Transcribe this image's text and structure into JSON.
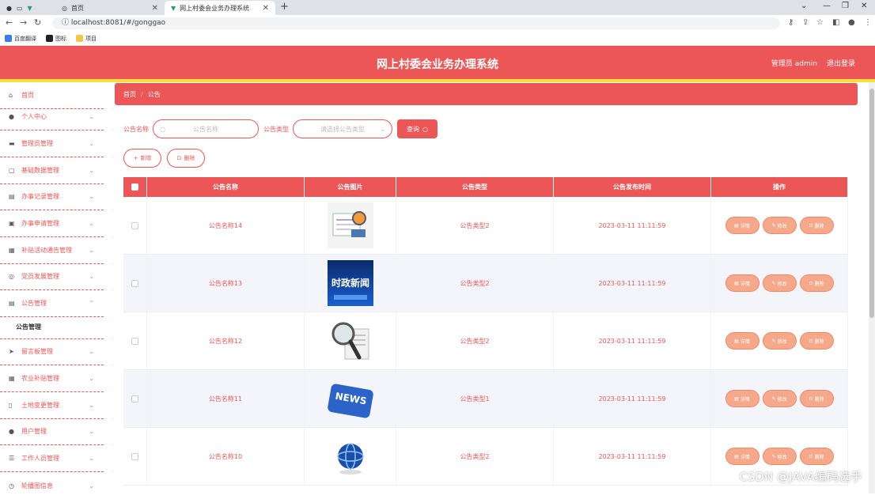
{
  "browser": {
    "tab1_title": "首页",
    "tab2_title": "网上村委会业务办理系统",
    "url": "localhost:8081/#/gonggao",
    "bookmarks": [
      "百度翻译",
      "图标",
      "项目"
    ]
  },
  "header": {
    "title": "网上村委会业务办理系统",
    "user_label": "管理员 admin",
    "logout_label": "退出登录"
  },
  "sidebar": {
    "items": [
      {
        "label": "首页",
        "icon": "home-icon"
      },
      {
        "label": "个人中心",
        "icon": "person-icon"
      },
      {
        "label": "管理员管理",
        "icon": "admin-icon"
      },
      {
        "label": "基础数据管理",
        "icon": "chat-icon"
      },
      {
        "label": "办事记录管理",
        "icon": "list-icon"
      },
      {
        "label": "办事申请管理",
        "icon": "briefcase-icon"
      },
      {
        "label": "补贴活动通告管理",
        "icon": "printer-icon"
      },
      {
        "label": "党员发展管理",
        "icon": "globe-icon"
      },
      {
        "label": "公告管理",
        "icon": "clipboard-icon"
      },
      {
        "label": "公告管理"
      },
      {
        "label": "留言板管理",
        "icon": "send-icon"
      },
      {
        "label": "农业补贴管理",
        "icon": "grid-icon"
      },
      {
        "label": "土地变更管理",
        "icon": "phone-icon"
      },
      {
        "label": "用户管理",
        "icon": "location-icon"
      },
      {
        "label": "工作人员管理",
        "icon": "menu-icon"
      },
      {
        "label": "轮播图信息",
        "icon": "clock-icon"
      }
    ]
  },
  "breadcrumb": {
    "home": "首页",
    "sep": "/",
    "current": "公告"
  },
  "search": {
    "name_label": "公告名称",
    "name_placeholder": "公告名称",
    "type_label": "公告类型",
    "type_placeholder": "请选择公告类型",
    "search_button": "查询"
  },
  "actions": {
    "add_label": "新增",
    "delete_label": "删除"
  },
  "table": {
    "headers": [
      "公告名称",
      "公告图片",
      "公告类型",
      "公告发布时间",
      "操作"
    ],
    "op_labels": {
      "detail": "详情",
      "edit": "修改",
      "delete": "删除"
    },
    "rows": [
      {
        "name": "公告名称14",
        "type": "公告类型2",
        "time": "2023-03-11 11:11:59",
        "image": "news-paper-image"
      },
      {
        "name": "公告名称13",
        "type": "公告类型2",
        "time": "2023-03-11 11:11:59",
        "image": "politics-news-image",
        "image_text": "时政新闻"
      },
      {
        "name": "公告名称12",
        "type": "公告类型2",
        "time": "2023-03-11 11:11:59",
        "image": "magnifier-news-image"
      },
      {
        "name": "公告名称11",
        "type": "公告类型1",
        "time": "2023-03-11 11:11:59",
        "image": "news-key-image",
        "image_text": "NEWS"
      },
      {
        "name": "公告名称10",
        "type": "公告类型2",
        "time": "2023-03-11 11:11:59",
        "image": "globe-news-image"
      }
    ]
  },
  "watermark": "CSDN @JAVA编码选手",
  "colors": {
    "primary": "#ec5656",
    "accent": "#f7e13b",
    "op_button": "#f6a98a"
  }
}
